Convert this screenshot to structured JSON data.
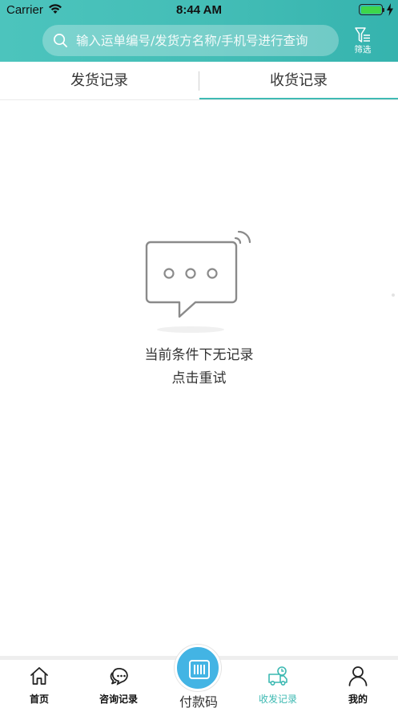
{
  "status_bar": {
    "carrier": "Carrier",
    "time": "8:44 AM",
    "battery_level": 1.0,
    "charging": true
  },
  "header": {
    "search_placeholder": "输入运单编号/发货方名称/手机号进行查询",
    "filter_label": "筛选",
    "colors": {
      "gradient_start": "#4cc4bd",
      "gradient_end": "#35b3ae"
    }
  },
  "tabs": [
    {
      "label": "发货记录",
      "active": false
    },
    {
      "label": "收货记录",
      "active": true
    }
  ],
  "empty_state": {
    "icon": "chat-bubble-empty-icon",
    "message": "当前条件下无记录",
    "retry_label": "点击重试"
  },
  "bottom_nav": {
    "items": [
      {
        "label": "首页",
        "icon": "home-icon",
        "active": false
      },
      {
        "label": "咨询记录",
        "icon": "chat-icon",
        "active": false
      },
      {
        "label": "付款码",
        "icon": "barcode-icon",
        "active": false
      },
      {
        "label": "收发记录",
        "icon": "truck-icon",
        "active": true
      },
      {
        "label": "我的",
        "icon": "user-icon",
        "active": false
      }
    ],
    "accent_color": "#3cb9b2",
    "pay_button_color": "#43b4e4"
  }
}
